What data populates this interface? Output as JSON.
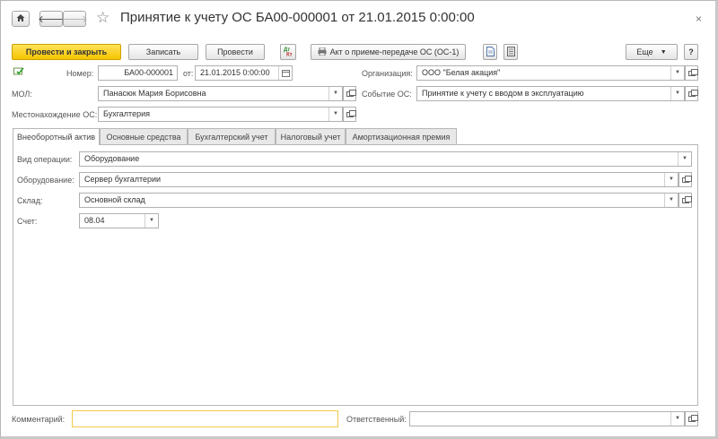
{
  "window": {
    "title": "Принятие к учету ОС БА00-000001 от 21.01.2015 0:00:00",
    "close_glyph": "×"
  },
  "toolbar": {
    "post_and_close": "Провести и закрыть",
    "save": "Записать",
    "post": "Провести",
    "act_print": "Акт о приеме-передаче ОС (ОС-1)",
    "more": "Еще",
    "help": "?"
  },
  "header": {
    "number_label": "Номер:",
    "number_value": "БА00-000001",
    "date_label": "от:",
    "date_value": "21.01.2015  0:00:00",
    "org_label": "Организация:",
    "org_value": "ООО \"Белая акация\"",
    "mol_label": "МОЛ:",
    "mol_value": "Панасюк Мария Борисовна",
    "event_label": "Событие ОС:",
    "event_value": "Принятие к учету с вводом в эксплуатацию",
    "location_label": "Местонахождение ОС:",
    "location_value": "Бухгалтерия"
  },
  "tabs": [
    {
      "label": "Внеоборотный актив",
      "active": true
    },
    {
      "label": "Основные средства",
      "active": false
    },
    {
      "label": "Бухгалтерский учет",
      "active": false
    },
    {
      "label": "Налоговый учет",
      "active": false
    },
    {
      "label": "Амортизационная премия",
      "active": false
    }
  ],
  "asset": {
    "operation_label": "Вид операции:",
    "operation_value": "Оборудование",
    "equipment_label": "Оборудование:",
    "equipment_value": "Сервер бухгалтерии",
    "warehouse_label": "Склад:",
    "warehouse_value": "Основной склад",
    "account_label": "Счет:",
    "account_value": "08.04"
  },
  "footer": {
    "comment_label": "Комментарий:",
    "comment_value": "",
    "responsible_label": "Ответственный:",
    "responsible_value": ""
  },
  "colors": {
    "primary_button": "#f5c400",
    "comment_border": "#f2c94c"
  }
}
